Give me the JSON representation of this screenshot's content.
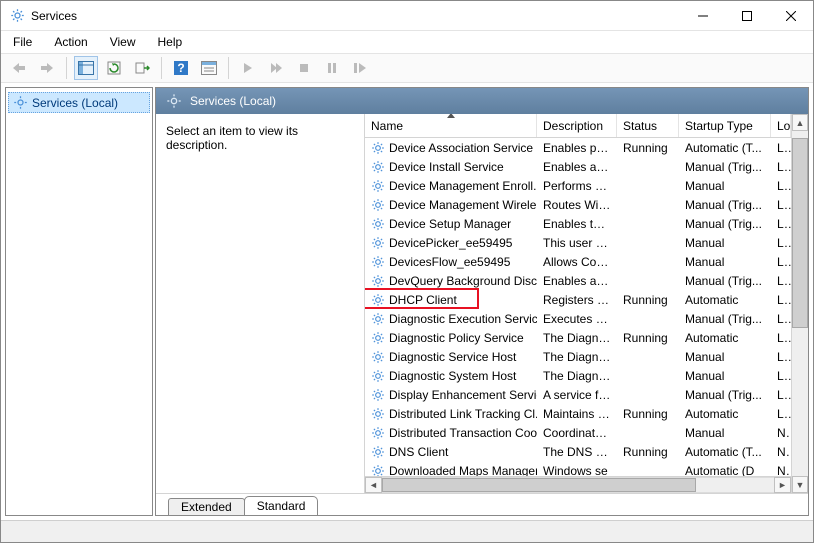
{
  "window": {
    "title": "Services"
  },
  "menu": {
    "file": "File",
    "action": "Action",
    "view": "View",
    "help": "Help"
  },
  "tree": {
    "root_label": "Services (Local)"
  },
  "panel": {
    "header": "Services (Local)",
    "description_prompt": "Select an item to view its description."
  },
  "columns": {
    "name": "Name",
    "description": "Description",
    "status": "Status",
    "startup_type": "Startup Type",
    "logon": "Log"
  },
  "tabs": {
    "extended": "Extended",
    "standard": "Standard"
  },
  "highlight_index": 8,
  "services": [
    {
      "name": "Device Association Service",
      "description": "Enables pair...",
      "status": "Running",
      "startup": "Automatic (T...",
      "logon": "Loc"
    },
    {
      "name": "Device Install Service",
      "description": "Enables a c...",
      "status": "",
      "startup": "Manual (Trig...",
      "logon": "Loc"
    },
    {
      "name": "Device Management Enroll...",
      "description": "Performs D...",
      "status": "",
      "startup": "Manual",
      "logon": "Loc"
    },
    {
      "name": "Device Management Wirele...",
      "description": "Routes Wire...",
      "status": "",
      "startup": "Manual (Trig...",
      "logon": "Loc"
    },
    {
      "name": "Device Setup Manager",
      "description": "Enables the ...",
      "status": "",
      "startup": "Manual (Trig...",
      "logon": "Loc"
    },
    {
      "name": "DevicePicker_ee59495",
      "description": "This user se...",
      "status": "",
      "startup": "Manual",
      "logon": "Loc"
    },
    {
      "name": "DevicesFlow_ee59495",
      "description": "Allows Con...",
      "status": "",
      "startup": "Manual",
      "logon": "Loc"
    },
    {
      "name": "DevQuery Background Disc...",
      "description": "Enables app...",
      "status": "",
      "startup": "Manual (Trig...",
      "logon": "Loc"
    },
    {
      "name": "DHCP Client",
      "description": "Registers an...",
      "status": "Running",
      "startup": "Automatic",
      "logon": "Loc"
    },
    {
      "name": "Diagnostic Execution Service",
      "description": "Executes dia...",
      "status": "",
      "startup": "Manual (Trig...",
      "logon": "Loc"
    },
    {
      "name": "Diagnostic Policy Service",
      "description": "The Diagno...",
      "status": "Running",
      "startup": "Automatic",
      "logon": "Loc"
    },
    {
      "name": "Diagnostic Service Host",
      "description": "The Diagno...",
      "status": "",
      "startup": "Manual",
      "logon": "Loc"
    },
    {
      "name": "Diagnostic System Host",
      "description": "The Diagno...",
      "status": "",
      "startup": "Manual",
      "logon": "Loc"
    },
    {
      "name": "Display Enhancement Service",
      "description": "A service fo...",
      "status": "",
      "startup": "Manual (Trig...",
      "logon": "Loc"
    },
    {
      "name": "Distributed Link Tracking Cl...",
      "description": "Maintains li...",
      "status": "Running",
      "startup": "Automatic",
      "logon": "Loc"
    },
    {
      "name": "Distributed Transaction Coo...",
      "description": "Coordinates...",
      "status": "",
      "startup": "Manual",
      "logon": "Net"
    },
    {
      "name": "DNS Client",
      "description": "The DNS Cli...",
      "status": "Running",
      "startup": "Automatic (T...",
      "logon": "Net"
    },
    {
      "name": "Downloaded Maps Manager",
      "description": "Windows se",
      "status": "",
      "startup": "Automatic (D",
      "logon": "Net"
    }
  ]
}
